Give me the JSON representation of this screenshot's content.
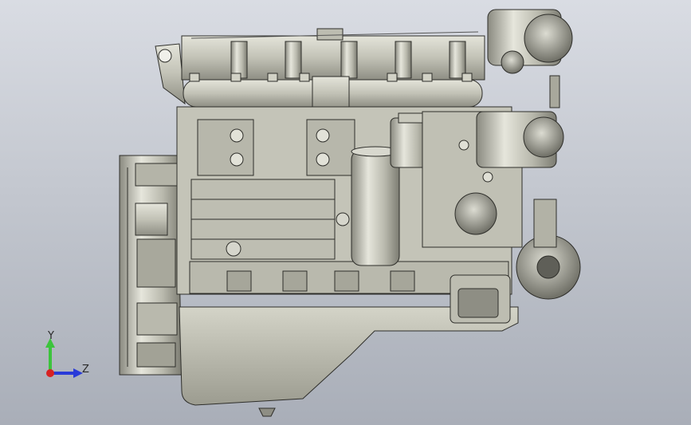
{
  "viewport": {
    "background_top": "#d9dce3",
    "background_bottom": "#a9aeb8",
    "model_color": "#c9c9bd"
  },
  "triad": {
    "y_label": "Y",
    "z_label": "Z",
    "y_color": "#3cc43c",
    "z_color": "#2a3bd8",
    "x_color": "#d82222"
  }
}
